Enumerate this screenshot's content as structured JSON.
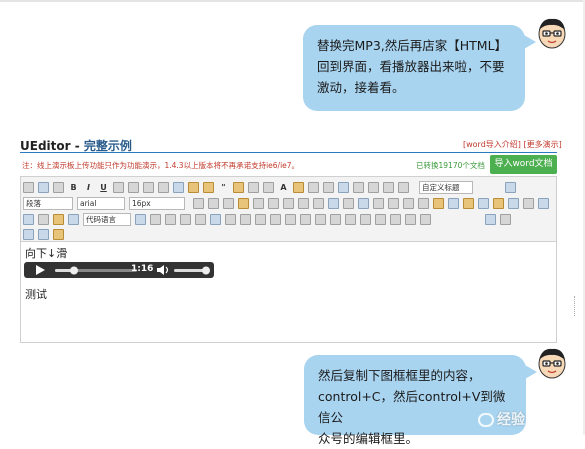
{
  "bubble_top": {
    "lines": [
      "替换完MP3,然后再店家【HTML】",
      "回到界面，看播放器出来啦，不要",
      "激动，接着看。"
    ]
  },
  "bubble_bottom": {
    "lines": [
      "然后复制下图框框里的内容，",
      "control+C，然后control+V到微信公",
      "众号的编辑框里。"
    ]
  },
  "editor": {
    "title": "UEditor - ",
    "title_sub": "完整示例",
    "links": "[word导入介绍] [更多演示]",
    "notice": "注：线上演示板上传功能只作为功能演示，1.4.3以上版本将不再承诺支持ie6/ie7。",
    "converted": "已转换19170个文档",
    "import_button": "导入word文档"
  },
  "toolbar": {
    "paragraph_select": "段落",
    "font_select": "arial",
    "size_select": "16px",
    "code_lang_select": "代码语言",
    "custom_title_select": "自定义标题"
  },
  "content": {
    "line1": "向下↓滑",
    "player_time": "1:16",
    "line2": "测试"
  },
  "watermark": "经验"
}
